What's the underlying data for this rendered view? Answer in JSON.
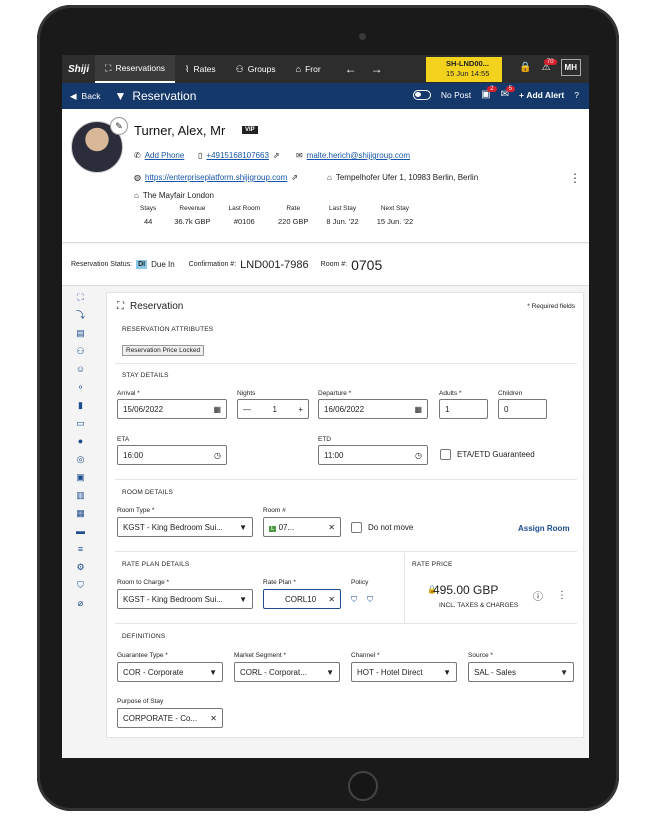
{
  "topbar": {
    "logo": "Shiji",
    "nav": [
      {
        "label": "Reservations"
      },
      {
        "label": "Rates"
      },
      {
        "label": "Groups"
      },
      {
        "label": "Fror"
      }
    ],
    "sh_line1": "SH-LND00...",
    "sh_line2": "15 Jun 14:55",
    "badge_alert": "70",
    "user": "MH"
  },
  "navbar": {
    "back": "Back",
    "title": "Reservation",
    "nopost": "No Post",
    "badge1": "2",
    "badge2": "5",
    "add_alert": "Add Alert"
  },
  "guest": {
    "name": "Turner, Alex, Mr",
    "vip": "VIP",
    "add_phone": "Add Phone",
    "phone": "+4915168107663",
    "email": "malte.herich@shijigroup.com",
    "website": "https://enterpriseplatform.shijigroup.com",
    "address": "Tempelhofer Ufer 1, 10983 Berlin, Berlin",
    "company": "The Mayfair London",
    "stats": [
      {
        "h": "Stays",
        "v": "44"
      },
      {
        "h": "Revenue",
        "v": "36.7k GBP"
      },
      {
        "h": "Last Room",
        "v": "#0106"
      },
      {
        "h": "Rate",
        "v": "220 GBP"
      },
      {
        "h": "Last Stay",
        "v": "8 Jun. '22"
      },
      {
        "h": "Next Stay",
        "v": "15 Jun. '22"
      }
    ]
  },
  "status": {
    "label": "Reservation Status:",
    "code": "DI",
    "value": "Due In",
    "conf_label": "Confirmation #:",
    "conf": "LND001-7986",
    "room_label": "Room #:",
    "room": "0705"
  },
  "form": {
    "title": "Reservation",
    "required": "* Required fields",
    "attr_title": "RESERVATION ATTRIBUTES",
    "chip": "Reservation Price Locked",
    "stay_title": "STAY DETAILS",
    "arrival_lbl": "Arrival *",
    "arrival": "15/06/2022",
    "nights_lbl": "Nights",
    "nights": "1",
    "departure_lbl": "Departure *",
    "departure": "16/06/2022",
    "adults_lbl": "Adults *",
    "adults": "1",
    "children_lbl": "Children",
    "children": "0",
    "eta_lbl": "ETA",
    "eta": "16:00",
    "etd_lbl": "ETD",
    "etd": "11:00",
    "guaranteed": "ETA/ETD Guaranteed",
    "room_title": "ROOM DETAILS",
    "roomtype_lbl": "Room Type *",
    "roomtype": "KGST - King Bedroom Sui...",
    "roomno_lbl": "Room #",
    "roomno": "07...",
    "donotmove": "Do not move",
    "assign": "Assign Room",
    "rate_title": "RATE PLAN DETAILS",
    "ratecharge_lbl": "Room to Charge *",
    "ratecharge": "KGST - King Bedroom Sui...",
    "rateplan_lbl": "Rate Plan *",
    "rateplan": "CORL10",
    "policy_lbl": "Policy",
    "rateprice_title": "RATE PRICE",
    "price": "495.00 GBP",
    "incl": "INCL. TAXES & CHARGES",
    "def_title": "DEFINITIONS",
    "guar_lbl": "Guarantee Type *",
    "guar": "COR - Corporate",
    "market_lbl": "Market Segment *",
    "market": "CORL - Corporat...",
    "channel_lbl": "Channel *",
    "channel": "HOT - Hotel Direct",
    "source_lbl": "Source *",
    "source": "SAL - Sales",
    "purpose_lbl": "Purpose of Stay",
    "purpose": "CORPORATE - Co..."
  }
}
